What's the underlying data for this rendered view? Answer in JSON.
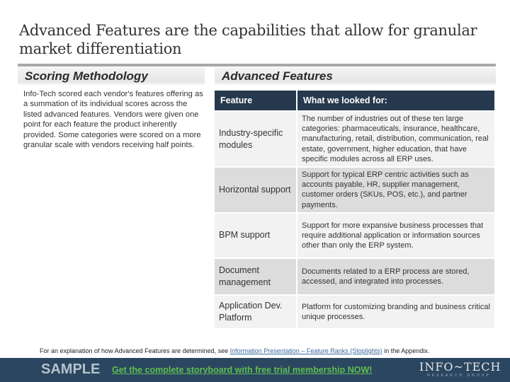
{
  "title": "Advanced Features are the capabilities that allow for granular market differentiation",
  "left": {
    "heading": "Scoring Methodology",
    "body": "Info-Tech scored each vendor's features offering as a summation of its individual scores across the listed advanced features. Vendors were given one point for each feature the product inherently provided. Some categories were scored on a more granular scale with vendors receiving half points."
  },
  "right": {
    "heading": "Advanced Features",
    "table": {
      "headers": [
        "Feature",
        "What we looked for:"
      ],
      "rows": [
        {
          "feature": "Industry-specific modules",
          "description": "The number of industries out of these ten large categories: pharmaceuticals, insurance, healthcare, manufacturing, retail, distribution, communication, real estate, government, higher education, that have specific modules across all ERP uses."
        },
        {
          "feature": "Horizontal support",
          "description": "Support for typical ERP centric activities such as accounts payable, HR, supplier management, customer orders (SKUs, POS, etc.), and partner payments."
        },
        {
          "feature": "BPM support",
          "description": "Support for more expansive business processes that require additional application or information sources other than only the ERP system."
        },
        {
          "feature": "Document management",
          "description": "Documents related to a ERP process are stored, accessed, and integrated into processes."
        },
        {
          "feature": "Application Dev. Platform",
          "description": "Platform for customizing branding and business critical unique processes."
        }
      ]
    }
  },
  "footnote": {
    "prefix": "For an explanation of how Advanced Features are determined, see ",
    "link": "Information Presentation – Feature Ranks (Stoplights)",
    "suffix": " in the Appendix."
  },
  "banner": {
    "sample": "SAMPLE",
    "cta": "Get the complete storyboard with free trial membership NOW!",
    "logo_main": "INFO~TECH",
    "logo_sub": "RESEARCH GROUP"
  }
}
